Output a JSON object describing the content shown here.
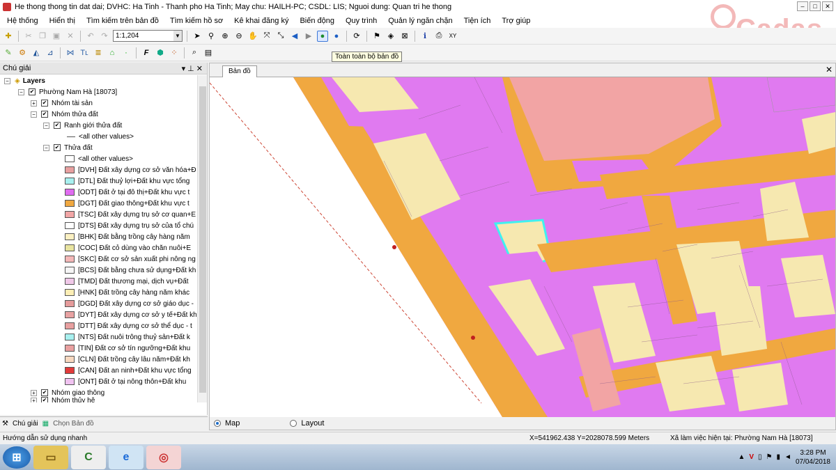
{
  "window": {
    "title": "He thong thong tin dat dai; DVHC: Ha Tinh - Thanh pho Ha Tinh; May chu: HAILH-PC; CSDL: LIS; Nguoi dung: Quan tri he thong",
    "min": "–",
    "max": "□",
    "close": "✕"
  },
  "logo": {
    "text": "Cadas"
  },
  "menu": [
    "Hệ thống",
    "Hiển thị",
    "Tìm kiếm trên bản đồ",
    "Tìm kiếm hồ sơ",
    "Kê khai đăng ký",
    "Biến động",
    "Quy trình",
    "Quản lý ngăn chặn",
    "Tiện ích",
    "Trợ giúp"
  ],
  "toolbar": {
    "scale_value": "1:1,204",
    "tooltip": "Toàn toàn bộ bản đồ"
  },
  "legend": {
    "title": "Chú giải",
    "pin": "▾ ⊥ ✕",
    "root": "Layers",
    "ward": "Phường Nam Hà [18073]",
    "group_assets": "Nhóm tài sản",
    "group_parcels": "Nhóm thửa đất",
    "boundary_layer": "Ranh giới thửa đất",
    "boundary_other": "<all other values>",
    "parcel_layer": "Thửa đất",
    "parcel_other": "<all other values>",
    "items": [
      {
        "label": "[DVH] Đất xây dựng cơ sở văn hóa+Đ",
        "color": "#e8a0a0"
      },
      {
        "label": "[DTL] Đất thuỷ lợi+Đất khu vực tổng",
        "color": "#a8f0ef"
      },
      {
        "label": "[ODT] Đất ở tại đô thị+Đất khu vực t",
        "color": "#e06cf0"
      },
      {
        "label": "[DGT] Đất giao thông+Đất khu vực t",
        "color": "#f0a840"
      },
      {
        "label": "[TSC] Đất xây dựng trụ sở cơ quan+E",
        "color": "#f2a6a6"
      },
      {
        "label": "[DTS] Đất xây dựng trụ sở của tổ chú",
        "color": "#ffffff"
      },
      {
        "label": "[BHK] Đất bằng trồng cây hàng năm",
        "color": "#fbf0c2"
      },
      {
        "label": "[COC] Đất cỏ dùng vào chăn nuôi+E",
        "color": "#e8e4a0"
      },
      {
        "label": "[SKC] Đất cơ sở sản xuất phi nông ng",
        "color": "#f4b8b8"
      },
      {
        "label": "[BCS] Đất bằng chưa sử dụng+Đất kh",
        "color": "#f6f6f6"
      },
      {
        "label": "[TMD] Đất thương mại, dịch vụ+Đất",
        "color": "#f0c8e8"
      },
      {
        "label": "[HNK] Đất trồng cây hàng năm khác",
        "color": "#fdeeb5"
      },
      {
        "label": "[DGD] Đất xây dựng cơ sở giáo dục -",
        "color": "#e59b9b"
      },
      {
        "label": "[DYT] Đất xây dựng cơ sở y tế+Đất kh",
        "color": "#e8a2a2"
      },
      {
        "label": "[DTT] Đất xây dựng cơ sở thể dục - t",
        "color": "#e8a0a0"
      },
      {
        "label": "[NTS] Đất nuôi trông thuỷ sản+Đất k",
        "color": "#a8f0ef"
      },
      {
        "label": "[TIN] Đất cơ sở tín ngưỡng+Đất khu",
        "color": "#e9a0a0"
      },
      {
        "label": "[CLN] Đất trồng cây lâu năm+Đất kh",
        "color": "#f8d8c0"
      },
      {
        "label": "[CAN] Đất an ninh+Đất khu vực tổng",
        "color": "#e23a3a"
      },
      {
        "label": "[ONT] Đất ở tại nông thôn+Đất khu",
        "color": "#f0c2f0"
      }
    ],
    "group_traffic": "Nhóm giao thông",
    "group_water": "Nhóm thủy hệ",
    "tab_legend": "Chú giải",
    "tab_choose_map": "Chọn Bản đồ"
  },
  "map": {
    "tab_label": "Bản đồ",
    "view_map": "Map",
    "view_layout": "Layout"
  },
  "status": {
    "help": "Hướng dẫn sử dụng nhanh",
    "coords": "X=541962.438 Y=2028078.599 Meters",
    "current_ward": "Xã làm việc hiện tại: Phường Nam Hà [18073]"
  },
  "tray": {
    "time": "3:28 PM",
    "date": "07/04/2018"
  }
}
